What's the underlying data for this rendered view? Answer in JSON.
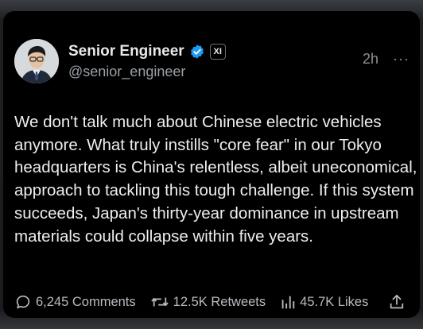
{
  "post": {
    "author_name": "Senior Engineer",
    "affiliate_badge": "XI",
    "handle": "@senior_engineer",
    "time": "2h",
    "more_label": "···",
    "text": "We don't talk much about Chinese electric vehicles anymore. What truly instills \"core fear\" in our Tokyo headquarters is China's relentless, albeit uneconomical, approach to tackling this tough challenge. If this system succeeds, Japan's thirty-year dominance in upstream materials could collapse within five years."
  },
  "actions": {
    "comments": "6,245 Comments",
    "retweets": "12.5K Retweets",
    "likes": "45.7K Likes"
  },
  "icons": {
    "verified": "verified-check-icon",
    "affiliate": "affiliate-badge-icon",
    "more": "more-dots-icon",
    "comment": "comment-bubble-icon",
    "retweet": "retweet-icon",
    "views": "views-bars-icon",
    "share": "share-icon"
  },
  "colors": {
    "background": "#000000",
    "verified": "#1d9bf0",
    "text": "#e7e9ea",
    "muted": "#8b9096"
  }
}
